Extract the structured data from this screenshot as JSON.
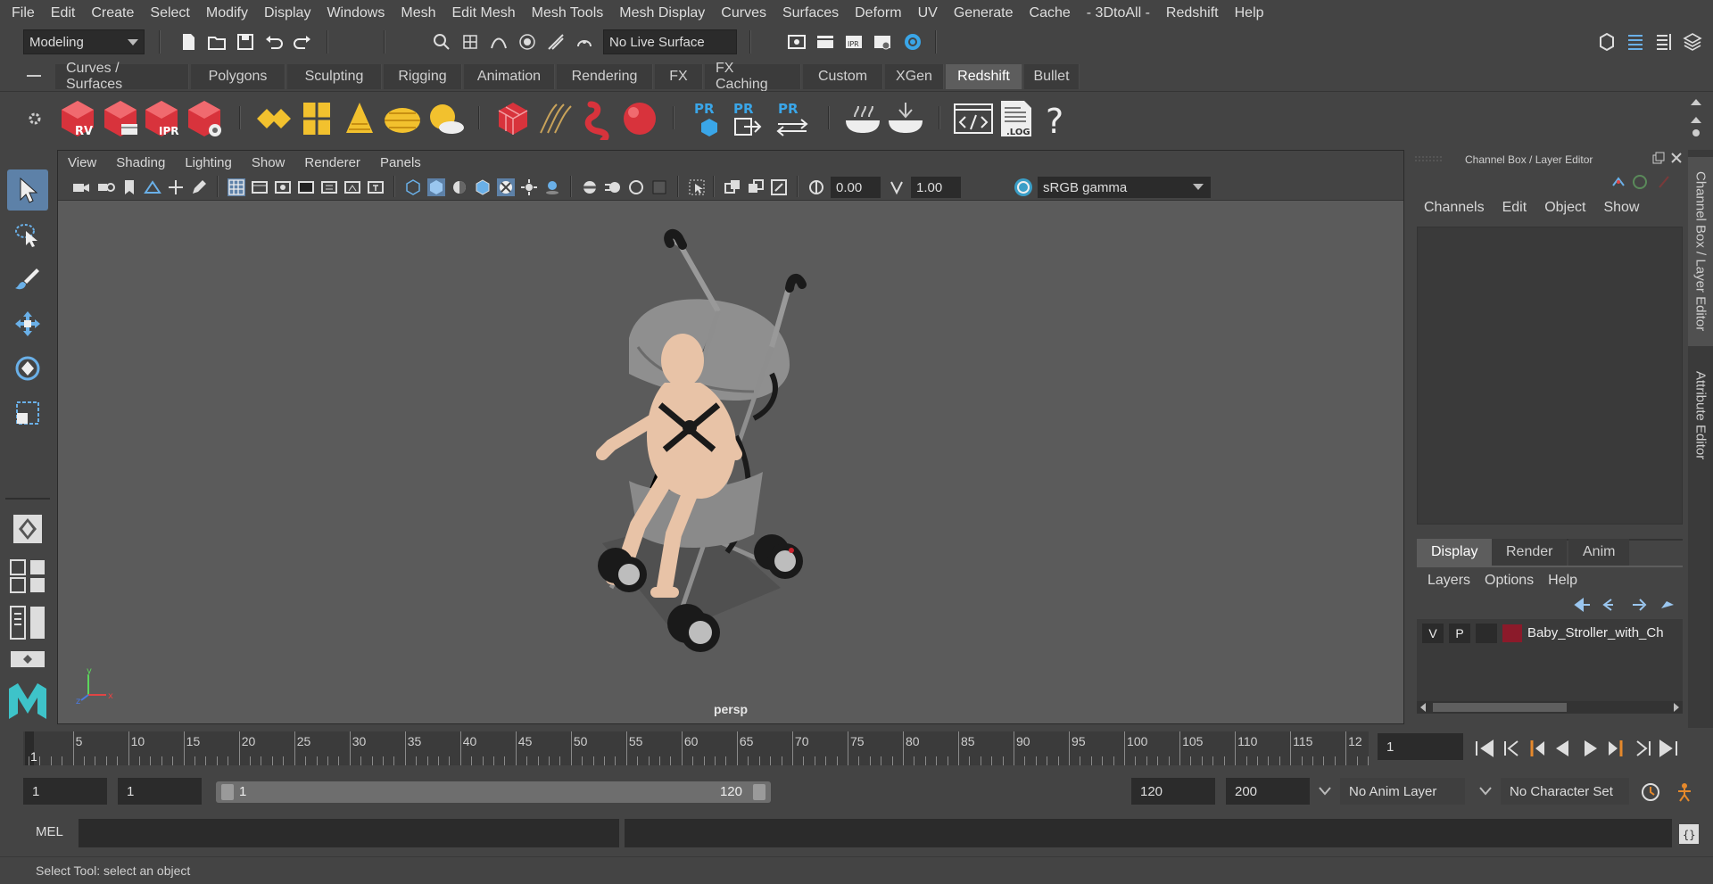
{
  "menu": [
    "File",
    "Edit",
    "Create",
    "Select",
    "Modify",
    "Display",
    "Windows",
    "Mesh",
    "Edit Mesh",
    "Mesh Tools",
    "Mesh Display",
    "Curves",
    "Surfaces",
    "Deform",
    "UV",
    "Generate",
    "Cache",
    "- 3DtoAll -",
    "Redshift",
    "Help"
  ],
  "statusline": {
    "mode": "Modeling",
    "live_surface": "No Live Surface"
  },
  "shelf_tabs": [
    "Curves / Surfaces",
    "Polygons",
    "Sculpting",
    "Rigging",
    "Animation",
    "Rendering",
    "FX",
    "FX Caching",
    "Custom",
    "XGen",
    "Redshift",
    "Bullet"
  ],
  "shelf_active": "Redshift",
  "shelf_labels": {
    "rv": "RV",
    "ipr": "IPR",
    "pr": "PR",
    "log": ".LOG",
    "help": "?"
  },
  "viewport": {
    "menu": [
      "View",
      "Shading",
      "Lighting",
      "Show",
      "Renderer",
      "Panels"
    ],
    "exposure": "0.00",
    "gamma": "1.00",
    "colorspace": "sRGB gamma",
    "camera": "persp",
    "axis": {
      "x": "x",
      "y": "y",
      "z": "z"
    }
  },
  "channelbox": {
    "title": "Channel Box / Layer Editor",
    "menu": [
      "Channels",
      "Edit",
      "Object",
      "Show"
    ]
  },
  "layer_editor": {
    "tabs": [
      "Display",
      "Render",
      "Anim"
    ],
    "active_tab": "Display",
    "menu": [
      "Layers",
      "Options",
      "Help"
    ],
    "layer": {
      "v": "V",
      "p": "P",
      "name": "Baby_Stroller_with_Ch",
      "color": "#8b1a2a"
    }
  },
  "side_tabs": [
    "Channel Box / Layer Editor",
    "Attribute Editor"
  ],
  "timeslider": {
    "ticks": [
      "5",
      "10",
      "15",
      "20",
      "25",
      "30",
      "35",
      "40",
      "45",
      "50",
      "55",
      "60",
      "65",
      "70",
      "75",
      "80",
      "85",
      "90",
      "95",
      "100",
      "105",
      "110",
      "115",
      "12"
    ],
    "current_label": "1",
    "current_frame": "1"
  },
  "range": {
    "start": "1",
    "playback_start": "1",
    "slider_start": "1",
    "slider_end": "120",
    "playback_end": "120",
    "end": "200",
    "anim_layer": "No Anim Layer",
    "char_set": "No Character Set"
  },
  "cmdline": {
    "lang": "MEL"
  },
  "help_line": "Select Tool: select an object",
  "colors": {
    "accent": "#5d81a8",
    "redshift_red": "#d8333c",
    "shelf_yellow": "#f2c12e",
    "pr_blue": "#3aa6e8"
  }
}
